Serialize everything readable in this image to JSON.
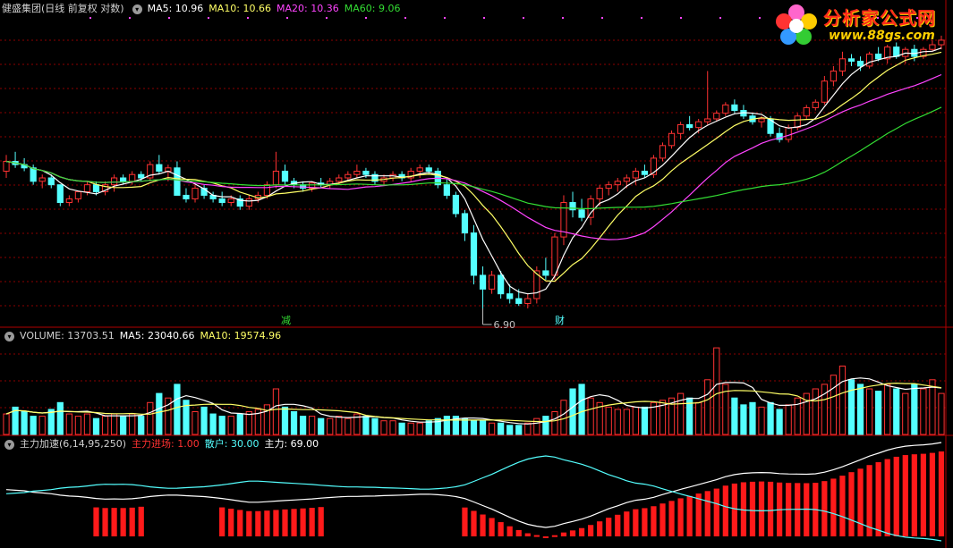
{
  "header": {
    "stock_title": "健盛集团(日线 前复权 对数)",
    "ma5": "MA5: 10.96",
    "ma10": "MA10: 10.66",
    "ma20": "MA20: 10.36",
    "ma60": "MA60: 9.06"
  },
  "volume_header": {
    "volume": "VOLUME: 13703.51",
    "ma5": "MA5: 23040.66",
    "ma10": "MA10: 19574.96"
  },
  "indicator_header": {
    "name": "主力加速(6,14,95,250)",
    "entry": "主力进场: 1.00",
    "retail": "散户: 30.00",
    "main": "主力: 69.00"
  },
  "annotations": {
    "low_label": "6.90",
    "marker_jian": "减",
    "marker_cai": "财"
  },
  "logo": {
    "title": "分析家公式网",
    "url": "www.88gs.com"
  },
  "colors": {
    "up": "#ff3232",
    "down": "#54ffff",
    "ma5": "#ffffff",
    "ma10": "#ffff66",
    "ma20": "#ff44ff",
    "ma60": "#33dd33",
    "grid": "#8b0000"
  },
  "chart_data": {
    "type": "candlestick",
    "candles": [
      [
        10.3,
        10.8,
        10.1,
        10.6
      ],
      [
        10.6,
        10.9,
        10.4,
        10.5
      ],
      [
        10.5,
        10.7,
        10.3,
        10.4
      ],
      [
        10.4,
        10.5,
        9.9,
        10.0
      ],
      [
        10.0,
        10.2,
        9.8,
        10.1
      ],
      [
        10.1,
        10.2,
        9.8,
        9.9
      ],
      [
        9.9,
        9.9,
        9.3,
        9.4
      ],
      [
        9.4,
        9.6,
        9.3,
        9.5
      ],
      [
        9.5,
        9.7,
        9.4,
        9.7
      ],
      [
        9.7,
        10.0,
        9.6,
        9.9
      ],
      [
        9.9,
        10.0,
        9.6,
        9.7
      ],
      [
        9.7,
        10.0,
        9.6,
        9.9
      ],
      [
        9.9,
        10.2,
        9.7,
        10.1
      ],
      [
        10.1,
        10.2,
        9.9,
        10.0
      ],
      [
        10.0,
        10.3,
        9.9,
        10.2
      ],
      [
        10.2,
        10.3,
        10.0,
        10.1
      ],
      [
        10.1,
        10.6,
        10.0,
        10.5
      ],
      [
        10.5,
        10.8,
        10.2,
        10.3
      ],
      [
        10.3,
        10.5,
        10.0,
        10.4
      ],
      [
        10.4,
        10.6,
        9.6,
        9.6
      ],
      [
        9.6,
        9.8,
        9.4,
        9.5
      ],
      [
        9.5,
        9.9,
        9.4,
        9.8
      ],
      [
        9.8,
        9.9,
        9.5,
        9.6
      ],
      [
        9.6,
        9.7,
        9.4,
        9.5
      ],
      [
        9.5,
        9.7,
        9.3,
        9.4
      ],
      [
        9.4,
        9.6,
        9.3,
        9.5
      ],
      [
        9.5,
        9.6,
        9.2,
        9.3
      ],
      [
        9.3,
        9.6,
        9.2,
        9.5
      ],
      [
        9.5,
        9.7,
        9.4,
        9.6
      ],
      [
        9.6,
        10.0,
        9.5,
        9.9
      ],
      [
        9.9,
        10.9,
        9.8,
        10.3
      ],
      [
        10.3,
        10.5,
        9.9,
        10.0
      ],
      [
        10.0,
        10.1,
        9.8,
        9.9
      ],
      [
        9.9,
        10.0,
        9.7,
        9.8
      ],
      [
        9.8,
        10.0,
        9.7,
        9.95
      ],
      [
        9.95,
        10.1,
        9.8,
        9.9
      ],
      [
        9.9,
        10.1,
        9.8,
        10.0
      ],
      [
        10.0,
        10.2,
        9.9,
        10.1
      ],
      [
        10.1,
        10.3,
        10.0,
        10.2
      ],
      [
        10.2,
        10.5,
        10.1,
        10.3
      ],
      [
        10.3,
        10.4,
        10.1,
        10.2
      ],
      [
        10.2,
        10.3,
        9.9,
        10.0
      ],
      [
        10.0,
        10.2,
        9.9,
        10.1
      ],
      [
        10.1,
        10.3,
        10.0,
        10.2
      ],
      [
        10.2,
        10.3,
        10.0,
        10.1
      ],
      [
        10.1,
        10.4,
        10.0,
        10.3
      ],
      [
        10.3,
        10.5,
        10.1,
        10.4
      ],
      [
        10.4,
        10.5,
        10.2,
        10.3
      ],
      [
        10.3,
        10.4,
        9.8,
        9.9
      ],
      [
        9.9,
        10.1,
        9.5,
        9.6
      ],
      [
        9.6,
        9.7,
        9.0,
        9.1
      ],
      [
        9.1,
        9.2,
        8.4,
        8.6
      ],
      [
        8.6,
        8.8,
        7.4,
        7.6
      ],
      [
        7.6,
        7.8,
        6.9,
        7.3
      ],
      [
        7.3,
        7.7,
        7.2,
        7.6
      ],
      [
        7.6,
        7.7,
        7.1,
        7.2
      ],
      [
        7.2,
        7.4,
        7.0,
        7.1
      ],
      [
        7.1,
        7.3,
        6.95,
        7.0
      ],
      [
        7.0,
        7.2,
        6.9,
        7.1
      ],
      [
        7.1,
        7.8,
        7.0,
        7.7
      ],
      [
        7.7,
        8.0,
        7.5,
        7.6
      ],
      [
        7.6,
        8.6,
        7.5,
        8.5
      ],
      [
        8.5,
        9.6,
        8.3,
        9.4
      ],
      [
        9.4,
        9.7,
        9.0,
        9.2
      ],
      [
        9.2,
        9.5,
        8.9,
        9.0
      ],
      [
        9.0,
        9.6,
        8.8,
        9.5
      ],
      [
        9.5,
        9.9,
        9.3,
        9.8
      ],
      [
        9.8,
        10.0,
        9.6,
        9.9
      ],
      [
        9.9,
        10.1,
        9.7,
        10.0
      ],
      [
        10.0,
        10.2,
        9.8,
        10.1
      ],
      [
        10.1,
        10.4,
        9.9,
        10.3
      ],
      [
        10.3,
        10.5,
        10.1,
        10.2
      ],
      [
        10.2,
        10.8,
        10.1,
        10.7
      ],
      [
        10.7,
        11.2,
        10.6,
        11.1
      ],
      [
        11.1,
        11.6,
        11.0,
        11.5
      ],
      [
        11.5,
        11.9,
        11.3,
        11.8
      ],
      [
        11.8,
        12.1,
        11.6,
        11.7
      ],
      [
        11.7,
        12.0,
        11.5,
        11.9
      ],
      [
        11.9,
        13.8,
        11.8,
        12.0
      ],
      [
        12.0,
        12.3,
        11.9,
        12.2
      ],
      [
        12.2,
        12.6,
        12.1,
        12.5
      ],
      [
        12.5,
        12.7,
        12.2,
        12.3
      ],
      [
        12.3,
        12.5,
        12.0,
        12.1
      ],
      [
        12.1,
        12.2,
        11.8,
        11.9
      ],
      [
        11.9,
        12.1,
        11.7,
        12.0
      ],
      [
        12.0,
        12.1,
        11.4,
        11.5
      ],
      [
        11.5,
        11.7,
        11.2,
        11.3
      ],
      [
        11.3,
        11.8,
        11.2,
        11.7
      ],
      [
        11.7,
        12.2,
        11.6,
        12.1
      ],
      [
        12.1,
        12.5,
        12.0,
        12.4
      ],
      [
        12.4,
        12.7,
        12.3,
        12.6
      ],
      [
        12.6,
        13.6,
        12.5,
        13.4
      ],
      [
        13.4,
        14.0,
        13.2,
        13.8
      ],
      [
        13.8,
        14.6,
        13.6,
        14.3
      ],
      [
        14.3,
        14.5,
        14.0,
        14.2
      ],
      [
        14.2,
        14.4,
        13.8,
        14.0
      ],
      [
        14.0,
        14.6,
        13.9,
        14.5
      ],
      [
        14.5,
        14.8,
        14.2,
        14.3
      ],
      [
        14.3,
        14.9,
        14.1,
        14.8
      ],
      [
        14.8,
        15.0,
        14.3,
        14.4
      ],
      [
        14.4,
        14.8,
        14.1,
        14.7
      ],
      [
        14.7,
        14.9,
        14.2,
        14.4
      ],
      [
        14.4,
        14.8,
        14.3,
        14.7
      ],
      [
        14.7,
        15.1,
        14.6,
        14.9
      ],
      [
        14.9,
        15.3,
        14.7,
        15.1
      ]
    ],
    "volumes": [
      9,
      12,
      10,
      8,
      8,
      11,
      14,
      9,
      8,
      9,
      7,
      8,
      9,
      8,
      9,
      8,
      14,
      18,
      16,
      22,
      15,
      10,
      12,
      9,
      8,
      8,
      9,
      10,
      11,
      13,
      20,
      12,
      10,
      8,
      8,
      7,
      7,
      8,
      7,
      9,
      8,
      7,
      6,
      6,
      5,
      5,
      5,
      6,
      7,
      8,
      8,
      7,
      6,
      6,
      5,
      5,
      4,
      4,
      5,
      7,
      8,
      10,
      15,
      20,
      22,
      16,
      14,
      12,
      11,
      11,
      12,
      12,
      14,
      15,
      16,
      18,
      16,
      14,
      24,
      38,
      22,
      16,
      13,
      14,
      12,
      14,
      11,
      13,
      16,
      18,
      20,
      22,
      26,
      30,
      24,
      22,
      20,
      19,
      22,
      20,
      18,
      22,
      20,
      24,
      18
    ],
    "volume_ma_labels": [
      "VOLUME",
      "MA5",
      "MA10"
    ],
    "indicator_params": [
      6,
      14,
      95,
      250
    ],
    "low_mark": 6.9
  }
}
